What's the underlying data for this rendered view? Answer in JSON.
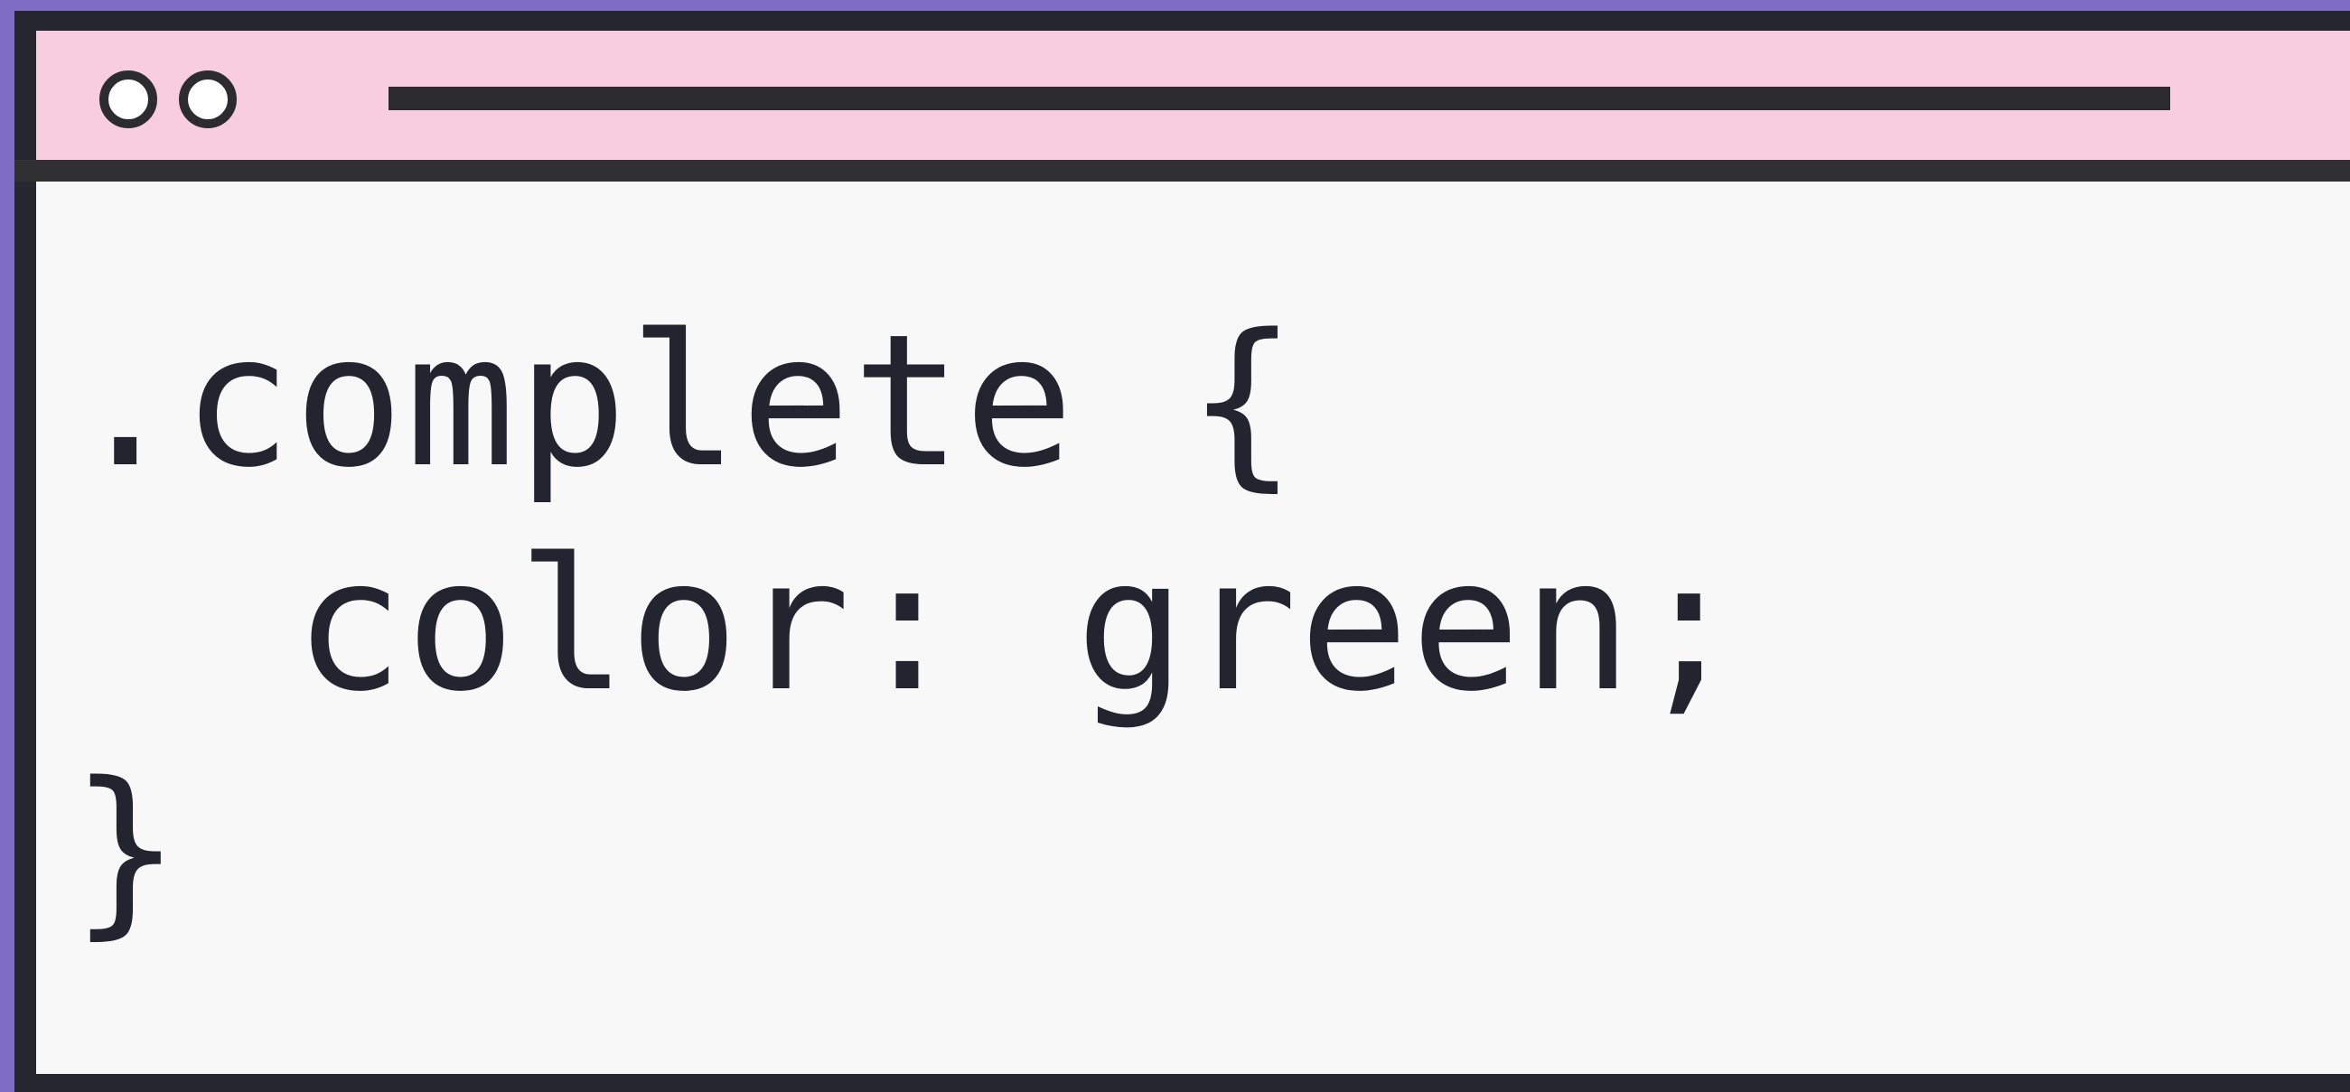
{
  "window": {
    "accent_color": "#7f6dc4",
    "titlebar_color": "#f8cde0",
    "editor_background": "#f8f8f8",
    "text_color": "#222430",
    "window_controls": [
      {
        "icon": "circle-dot-icon"
      },
      {
        "icon": "circle-dot-icon"
      }
    ]
  },
  "code": {
    "line1": ".complete {",
    "line2": "  color: green;",
    "line3": "}"
  }
}
